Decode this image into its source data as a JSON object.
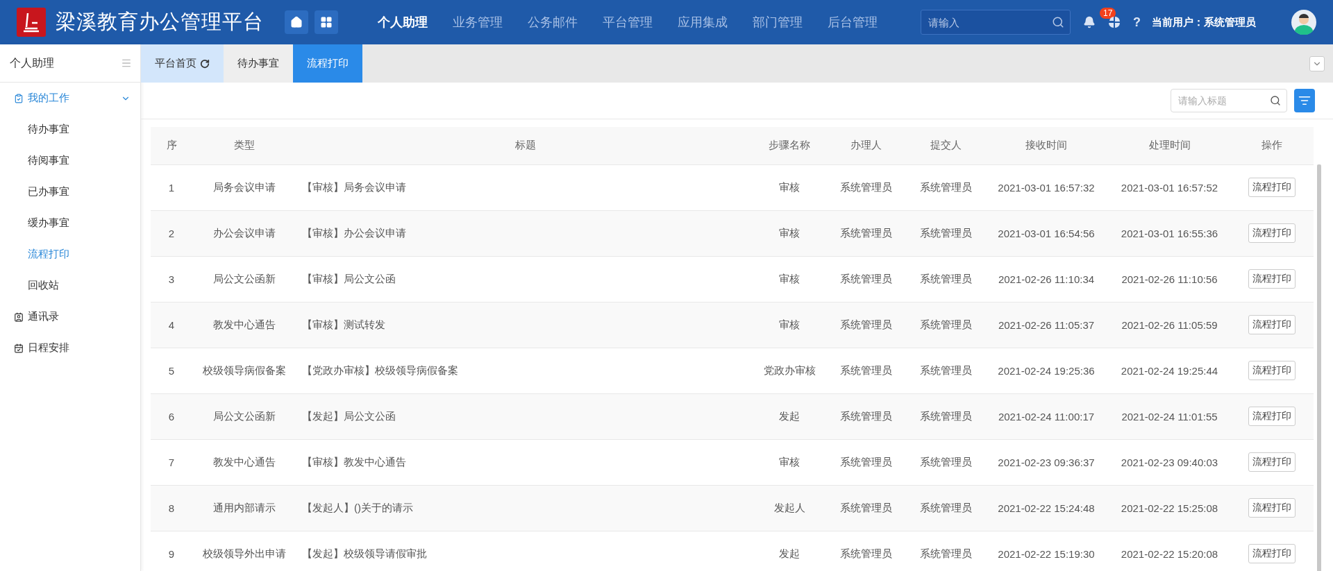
{
  "header": {
    "title": "梁溪教育办公管理平台",
    "nav": [
      {
        "label": "个人助理",
        "selected": true
      },
      {
        "label": "业务管理",
        "selected": false
      },
      {
        "label": "公务邮件",
        "selected": false
      },
      {
        "label": "平台管理",
        "selected": false
      },
      {
        "label": "应用集成",
        "selected": false
      },
      {
        "label": "部门管理",
        "selected": false
      },
      {
        "label": "后台管理",
        "selected": false
      }
    ],
    "search": {
      "placeholder": "请输入"
    },
    "notifications": "17",
    "help": "?",
    "user": "当前用户：系统管理员"
  },
  "sidebar": {
    "title": "个人助理",
    "items": [
      {
        "label": "我的工作",
        "expanded": true,
        "selected": false,
        "children": [
          {
            "label": "待办事宜",
            "selected": false
          },
          {
            "label": "待阅事宜",
            "selected": false
          },
          {
            "label": "已办事宜",
            "selected": false
          },
          {
            "label": "缓办事宜",
            "selected": false
          },
          {
            "label": "流程打印",
            "selected": true
          },
          {
            "label": "回收站",
            "selected": false
          }
        ]
      },
      {
        "label": "通讯录",
        "expanded": false,
        "selected": false
      },
      {
        "label": "日程安排",
        "expanded": false,
        "selected": false
      }
    ]
  },
  "tabs": [
    {
      "label": "平台首页",
      "kind": "home",
      "selected": false
    },
    {
      "label": "待办事宜",
      "kind": "plain",
      "selected": false
    },
    {
      "label": "流程打印",
      "kind": "plain",
      "selected": true
    }
  ],
  "search": {
    "placeholder": "请输入标题"
  },
  "table": {
    "columns": [
      "序",
      "类型",
      "标题",
      "步骤名称",
      "办理人",
      "提交人",
      "接收时间",
      "处理时间",
      "操作"
    ],
    "rows": [
      [
        "1",
        "局务会议申请",
        "【审核】局务会议申请",
        "审核",
        "系统管理员",
        "系统管理员",
        "2021-03-01 16:57:32",
        "2021-03-01 16:57:52",
        "流程打印"
      ],
      [
        "2",
        "办公会议申请",
        "【审核】办公会议申请",
        "审核",
        "系统管理员",
        "系统管理员",
        "2021-03-01 16:54:56",
        "2021-03-01 16:55:36",
        "流程打印"
      ],
      [
        "3",
        "局公文公函新",
        "【审核】局公文公函",
        "审核",
        "系统管理员",
        "系统管理员",
        "2021-02-26 11:10:34",
        "2021-02-26 11:10:56",
        "流程打印"
      ],
      [
        "4",
        "教发中心通告",
        "【审核】测试转发",
        "审核",
        "系统管理员",
        "系统管理员",
        "2021-02-26 11:05:37",
        "2021-02-26 11:05:59",
        "流程打印"
      ],
      [
        "5",
        "校级领导病假备案",
        "【党政办审核】校级领导病假备案",
        "党政办审核",
        "系统管理员",
        "系统管理员",
        "2021-02-24 19:25:36",
        "2021-02-24 19:25:44",
        "流程打印"
      ],
      [
        "6",
        "局公文公函新",
        "【发起】局公文公函",
        "发起",
        "系统管理员",
        "系统管理员",
        "2021-02-24 11:00:17",
        "2021-02-24 11:01:55",
        "流程打印"
      ],
      [
        "7",
        "教发中心通告",
        "【审核】教发中心通告",
        "审核",
        "系统管理员",
        "系统管理员",
        "2021-02-23 09:36:37",
        "2021-02-23 09:40:03",
        "流程打印"
      ],
      [
        "8",
        "通用内部请示",
        "【发起人】()关于的请示",
        "发起人",
        "系统管理员",
        "系统管理员",
        "2021-02-22 15:24:48",
        "2021-02-22 15:25:08",
        "流程打印"
      ],
      [
        "9",
        "校级领导外出申请",
        "【发起】校级领导请假审批",
        "发起",
        "系统管理员",
        "系统管理员",
        "2021-02-22 15:19:30",
        "2021-02-22 15:20:08",
        "流程打印"
      ]
    ]
  }
}
